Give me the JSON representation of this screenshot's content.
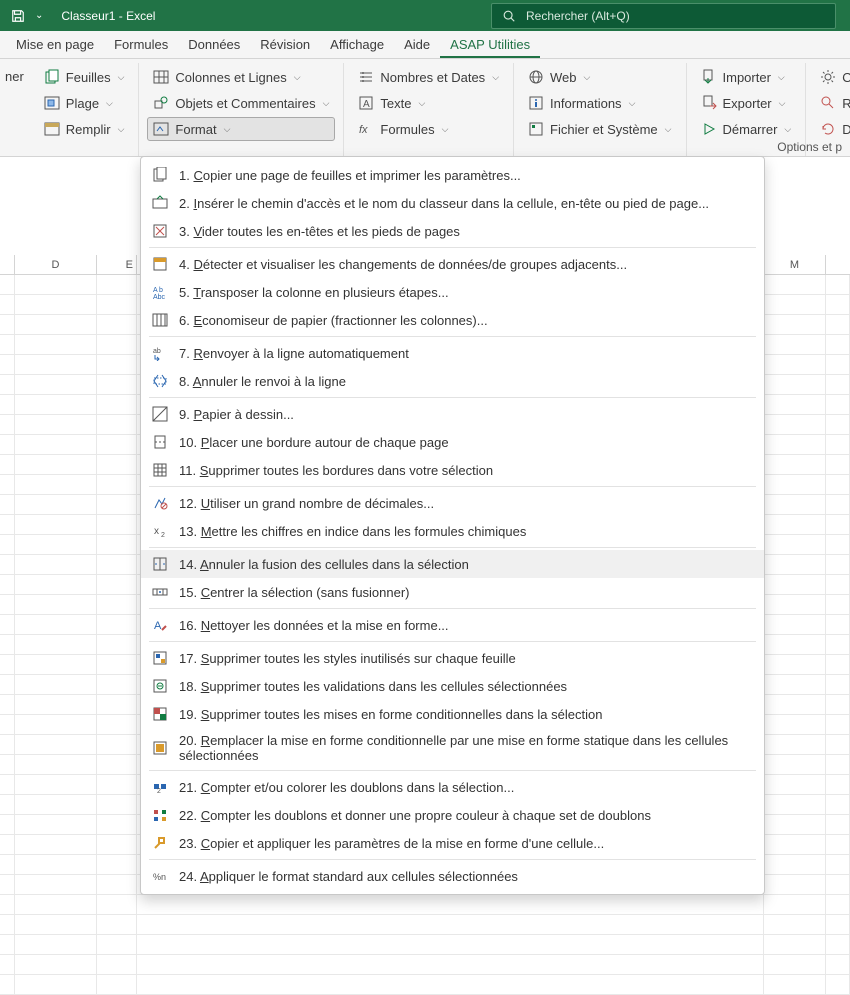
{
  "titlebar": {
    "doc_title": "Classeur1 - Excel",
    "search_placeholder": "Rechercher (Alt+Q)"
  },
  "tabs": {
    "mise_en_page": "Mise en page",
    "formules": "Formules",
    "donnees": "Données",
    "revision": "Révision",
    "affichage": "Affichage",
    "aide": "Aide",
    "asap": "ASAP Utilities"
  },
  "ribbon": {
    "left_partial": "ner",
    "feuilles": "Feuilles",
    "plage": "Plage",
    "remplir": "Remplir",
    "colonnes_lignes": "Colonnes et Lignes",
    "objets_commentaires": "Objets et Commentaires",
    "format": "Format",
    "nombres_dates": "Nombres et Dates",
    "texte": "Texte",
    "formules_btn": "Formules",
    "web": "Web",
    "informations": "Informations",
    "fichier_systeme": "Fichier et Système",
    "importer": "Importer",
    "exporter": "Exporter",
    "demarrer": "Démarrer",
    "options_asap": "Options ASAP Uti",
    "rechercher_dem": "Rechercher et dém",
    "demarrez_dernier": "Démarrez dernier",
    "options_partial": "Options et p"
  },
  "columns": {
    "D": "D",
    "E": "E",
    "M": "M"
  },
  "menu": {
    "items": [
      {
        "n": "1.",
        "label": "Copier une page de feuilles et imprimer les paramètres..."
      },
      {
        "n": "2.",
        "label": "Insérer le chemin d'accès et le nom du classeur dans la cellule, en-tête ou pied de page..."
      },
      {
        "n": "3.",
        "label": "Vider toutes les en-têtes et les pieds de pages"
      },
      {
        "n": "4.",
        "label": "Détecter et visualiser les changements de données/de groupes adjacents..."
      },
      {
        "n": "5.",
        "label": "Transposer la colonne en plusieurs étapes..."
      },
      {
        "n": "6.",
        "label": "Economiseur de papier (fractionner les colonnes)..."
      },
      {
        "n": "7.",
        "label": "Renvoyer à la ligne automatiquement"
      },
      {
        "n": "8.",
        "label": "Annuler le renvoi à la ligne"
      },
      {
        "n": "9.",
        "label": "Papier à dessin..."
      },
      {
        "n": "10.",
        "label": "Placer une bordure autour de chaque page"
      },
      {
        "n": "11.",
        "label": "Supprimer toutes les bordures dans votre sélection"
      },
      {
        "n": "12.",
        "label": "Utiliser un grand nombre de décimales..."
      },
      {
        "n": "13.",
        "label": "Mettre les chiffres en indice dans les formules chimiques"
      },
      {
        "n": "14.",
        "label": "Annuler la fusion des cellules dans la sélection"
      },
      {
        "n": "15.",
        "label": "Centrer la sélection (sans fusionner)"
      },
      {
        "n": "16.",
        "label": "Nettoyer les données et la mise en forme..."
      },
      {
        "n": "17.",
        "label": "Supprimer toutes les  styles inutilisés sur chaque feuille"
      },
      {
        "n": "18.",
        "label": "Supprimer toutes les validations dans les cellules sélectionnées"
      },
      {
        "n": "19.",
        "label": "Supprimer toutes les mises en forme conditionnelles dans la sélection"
      },
      {
        "n": "20.",
        "label": "Remplacer la mise en forme conditionnelle par une mise en forme statique dans les cellules sélectionnées"
      },
      {
        "n": "21.",
        "label": "Compter et/ou colorer les doublons dans la sélection..."
      },
      {
        "n": "22.",
        "label": "Compter les doublons et donner une propre couleur à chaque set de doublons"
      },
      {
        "n": "23.",
        "label": "Copier et appliquer les paramètres de la mise en forme d'une cellule..."
      },
      {
        "n": "24.",
        "label": "Appliquer le format standard aux cellules sélectionnées"
      }
    ]
  }
}
